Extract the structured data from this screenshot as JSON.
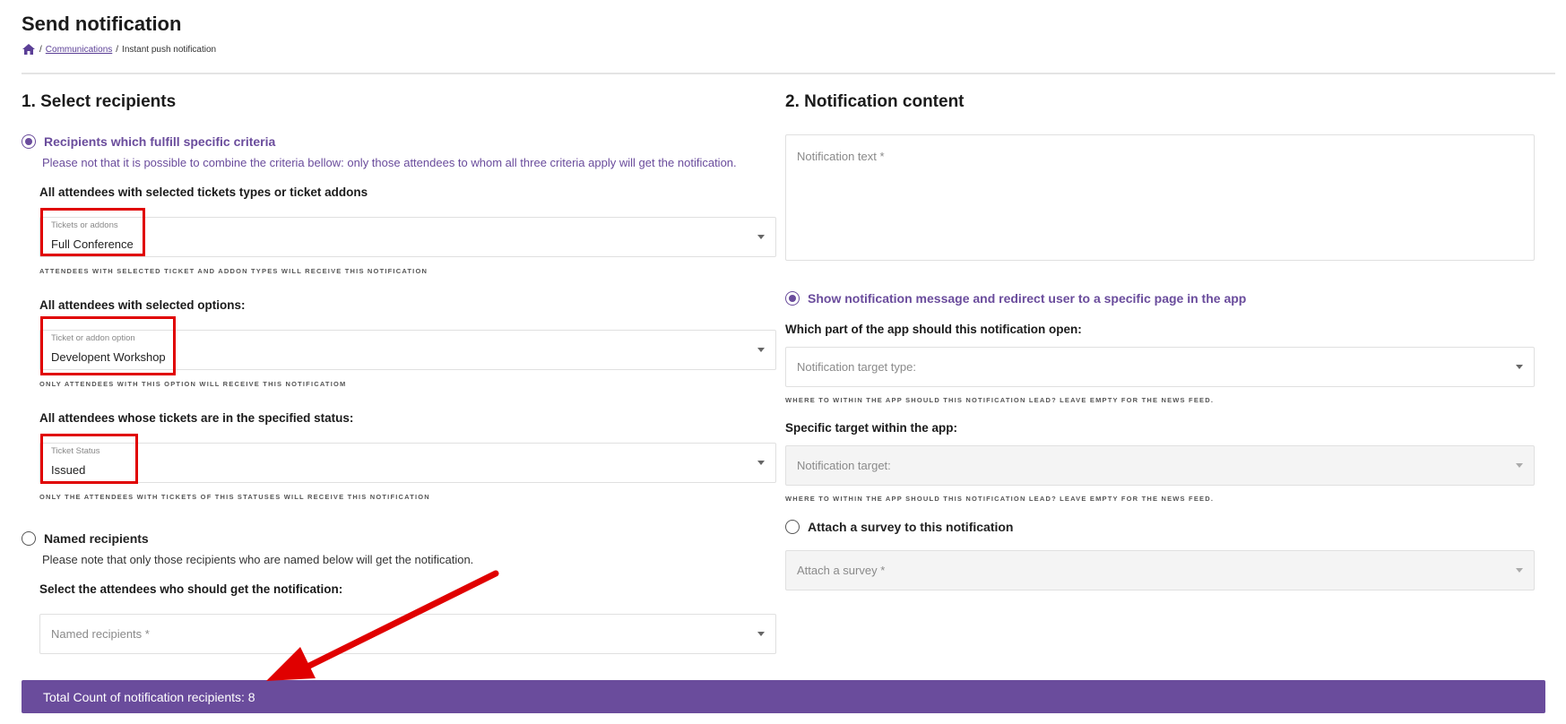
{
  "page": {
    "title": "Send notification",
    "breadcrumb": {
      "parent": "Communications",
      "separator": "/",
      "current": "Instant push notification"
    }
  },
  "recipients": {
    "section_title": "1. Select recipients",
    "criteria_option": {
      "label": "Recipients which fulfill specific criteria",
      "selected": true,
      "description": "Please not that it is possible to combine the criteria bellow: only those attendees to whom all three criteria apply will get the notification."
    },
    "tickets": {
      "label": "All attendees with selected tickets types or ticket addons",
      "field_label": "Tickets or addons",
      "value": "Full Conference",
      "hint": "Attendees with selected ticket and addon types will receive this notification"
    },
    "options": {
      "label": "All attendees with selected options:",
      "field_label": "Ticket or addon option",
      "value": "Developent Workshop",
      "hint": "Only attendees with this option will receive this notificatiom"
    },
    "status": {
      "label": "All attendees whose tickets are in the specified status:",
      "field_label": "Ticket Status",
      "value": "Issued",
      "hint": "Only the attendees with tickets of this statuses will receive this notification"
    },
    "named_option": {
      "label": "Named recipients",
      "selected": false,
      "description": "Please note that only those recipients who are named below will get the notification."
    },
    "named_select": {
      "label": "Select the attendees who should get the notification:",
      "placeholder": "Named recipients *"
    }
  },
  "content": {
    "section_title": "2. Notification content",
    "text_placeholder": "Notification text *",
    "redirect_option": {
      "label": "Show notification message and redirect user to a specific page in the app",
      "selected": true
    },
    "target_type": {
      "label": "Which part of the app should this notification open:",
      "placeholder": "Notification target type:",
      "hint": "Where to within the app should this notification lead? Leave empty for the news feed."
    },
    "target": {
      "label": "Specific target within the app:",
      "placeholder": "Notification target:",
      "hint": "Where to within the app should this notification lead? Leave empty for the news feed."
    },
    "survey_option": {
      "label": "Attach a survey to this notification",
      "selected": false
    },
    "survey_placeholder": "Attach a survey *"
  },
  "total": {
    "text": "Total Count of notification recipients: 8"
  },
  "colors": {
    "accent": "#6a4c9c",
    "annotation": "#e00000"
  },
  "icons": {
    "home": "home-icon",
    "dropdown": "chevron-down-icon"
  }
}
